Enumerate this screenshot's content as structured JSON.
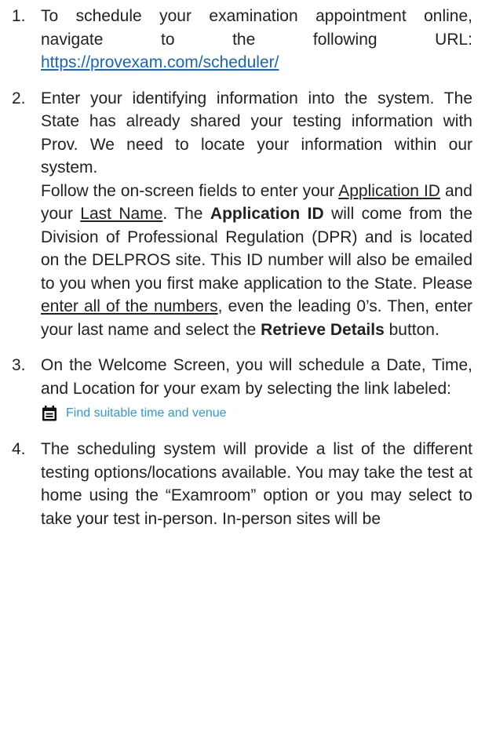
{
  "steps": [
    {
      "number": "1.",
      "text_a": "To schedule your examination appointment online, navigate to the following URL: ",
      "url": "https://provexam.com/scheduler/"
    },
    {
      "number": "2.",
      "p1": "Enter your identifying information into the system.  The State has already shared your testing information with Prov.  We need to locate your information within our system.",
      "p2_a": "Follow the on-screen fields to enter your ",
      "p2_appid": "Application ID",
      "p2_b": " and your ",
      "p2_lastname": "Last Name",
      "p2_c": ".  The ",
      "p2_appid_bold": "Application ID",
      "p2_d": " will come from the Division of Professional Regulation (DPR) and is located on the DELPROS site.  This ID number will also be emailed to you when you first make application to the State.  Please ",
      "p2_numbers": "enter all of the numbers",
      "p2_e": ", even the leading 0’s. Then, enter your last name and select the ",
      "p2_retrieve": "Retrieve Details",
      "p2_f": " button."
    },
    {
      "number": "3.",
      "text": "On the Welcome Screen, you will schedule a Date, Time, and Location for your exam by selecting the link labeled:",
      "link_label": "Find suitable time and venue",
      "link_icon": "calendar-icon"
    },
    {
      "number": "4.",
      "text": "The scheduling system will provide a list of the different testing options/locations available. You may take the test at home using the “Examroom” option or you may select to take your test in-person.  In-person sites will be"
    }
  ],
  "colors": {
    "link": "#1565c0",
    "cta": "#2d9ad6",
    "text": "#222222"
  }
}
